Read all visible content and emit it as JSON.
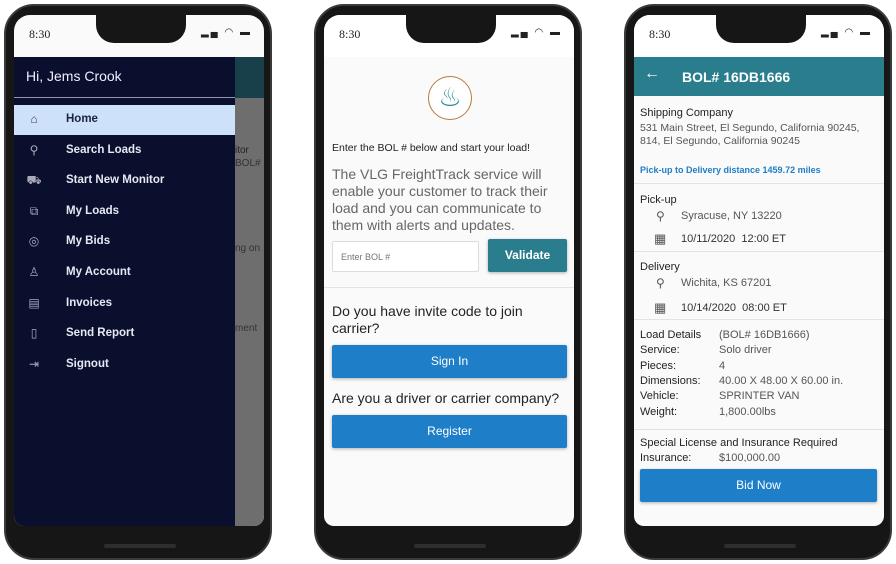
{
  "status": {
    "time": "8:30"
  },
  "phone1": {
    "greeting": "Hi, Jems Crook",
    "menu": [
      {
        "label": "Home",
        "icon": "home-icon",
        "glyph": "⌂",
        "active": true
      },
      {
        "label": "Search Loads",
        "icon": "search-icon",
        "glyph": "⚲"
      },
      {
        "label": "Start New Monitor",
        "icon": "truck-icon",
        "glyph": "⛟"
      },
      {
        "label": "My Loads",
        "icon": "box-icon",
        "glyph": "⧉"
      },
      {
        "label": "My Bids",
        "icon": "coins-icon",
        "glyph": "◎"
      },
      {
        "label": "My Account",
        "icon": "user-icon",
        "glyph": "♙"
      },
      {
        "label": "Invoices",
        "icon": "list-icon",
        "glyph": "▤"
      },
      {
        "label": "Send Report",
        "icon": "document-icon",
        "glyph": "▯"
      },
      {
        "label": "Signout",
        "icon": "signout-icon",
        "glyph": "⇥"
      }
    ],
    "background_fragments": [
      "itor",
      "BOL#",
      "ng on",
      "ment"
    ]
  },
  "phone2": {
    "intro": "Enter the BOL # below and start your load!",
    "description": "The VLG FreightTrack service will enable your customer to track their load and you can communicate to them with alerts and updates.",
    "bol_placeholder": "Enter BOL #",
    "validate_label": "Validate",
    "invite_question": "Do you have invite code to join carrier?",
    "signin_label": "Sign In",
    "driver_question": "Are you a driver or carrier company?",
    "register_label": "Register"
  },
  "phone3": {
    "title": "BOL# 16DB1666",
    "shipping_label": "Shipping Company",
    "shipping_address": "531 Main Street, El Segundo, California 90245, 814, El Segundo, California 90245",
    "distance": "Pick-up to Delivery distance 1459.72 miles",
    "pickup_label": "Pick-up",
    "pickup_location": "Syracuse, NY 13220",
    "pickup_datetime": "10/11/2020  12:00 ET",
    "delivery_label": "Delivery",
    "delivery_location": "Wichita, KS 67201",
    "delivery_datetime": "10/14/2020  08:00 ET",
    "details": [
      {
        "k": "Load Details",
        "v": "(BOL# 16DB1666)"
      },
      {
        "k": "Service:",
        "v": "Solo driver"
      },
      {
        "k": "Pieces:",
        "v": "4"
      },
      {
        "k": "Dimensions:",
        "v": "40.00 X 48.00 X 60.00 in."
      },
      {
        "k": "Vehicle:",
        "v": "SPRINTER VAN"
      },
      {
        "k": "Weight:",
        "v": "1,800.00lbs"
      }
    ],
    "license_label": "Special License and Insurance Required",
    "insurance_key": "Insurance:",
    "insurance_value": "$100,000.00",
    "bid_label": "Bid Now"
  },
  "colors": {
    "drawer": "#0a0f2e",
    "active": "#cde1fb",
    "teal": "#2a7d8c",
    "blue": "#1e7ec8"
  }
}
